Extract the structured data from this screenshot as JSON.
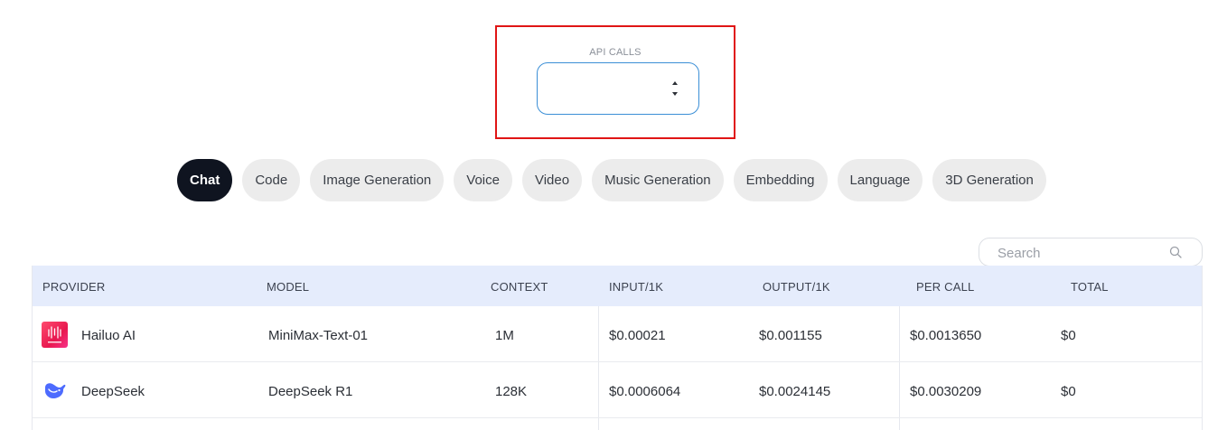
{
  "api_calls": {
    "label": "API CALLS",
    "value": ""
  },
  "tabs": [
    {
      "label": "Chat",
      "active": true
    },
    {
      "label": "Code",
      "active": false
    },
    {
      "label": "Image Generation",
      "active": false
    },
    {
      "label": "Voice",
      "active": false
    },
    {
      "label": "Video",
      "active": false
    },
    {
      "label": "Music Generation",
      "active": false
    },
    {
      "label": "Embedding",
      "active": false
    },
    {
      "label": "Language",
      "active": false
    },
    {
      "label": "3D Generation",
      "active": false
    }
  ],
  "search": {
    "placeholder": "Search",
    "icon": "search-icon"
  },
  "table": {
    "headers": {
      "provider": "PROVIDER",
      "model": "MODEL",
      "context": "CONTEXT",
      "input": "INPUT/1K",
      "output": "OUTPUT/1K",
      "per_call": "PER CALL",
      "total": "TOTAL"
    },
    "rows": [
      {
        "provider": "Hailuo AI",
        "provider_icon": "hailuo-logo-icon",
        "model": "MiniMax-Text-01",
        "context": "1M",
        "input": "$0.00021",
        "output": "$0.001155",
        "per_call": "$0.0013650",
        "total": "$0"
      },
      {
        "provider": "DeepSeek",
        "provider_icon": "deepseek-logo-icon",
        "model": "DeepSeek R1",
        "context": "128K",
        "input": "$0.0006064",
        "output": "$0.0024145",
        "per_call": "$0.0030209",
        "total": "$0"
      }
    ]
  },
  "colors": {
    "highlight_border": "#e01515",
    "input_focus_border": "#3b8fd6",
    "active_tab_bg": "#0f1420",
    "tab_bg": "#ececec",
    "table_header_bg": "#e5ecfc",
    "deepseek_blue": "#4d6bfe"
  }
}
